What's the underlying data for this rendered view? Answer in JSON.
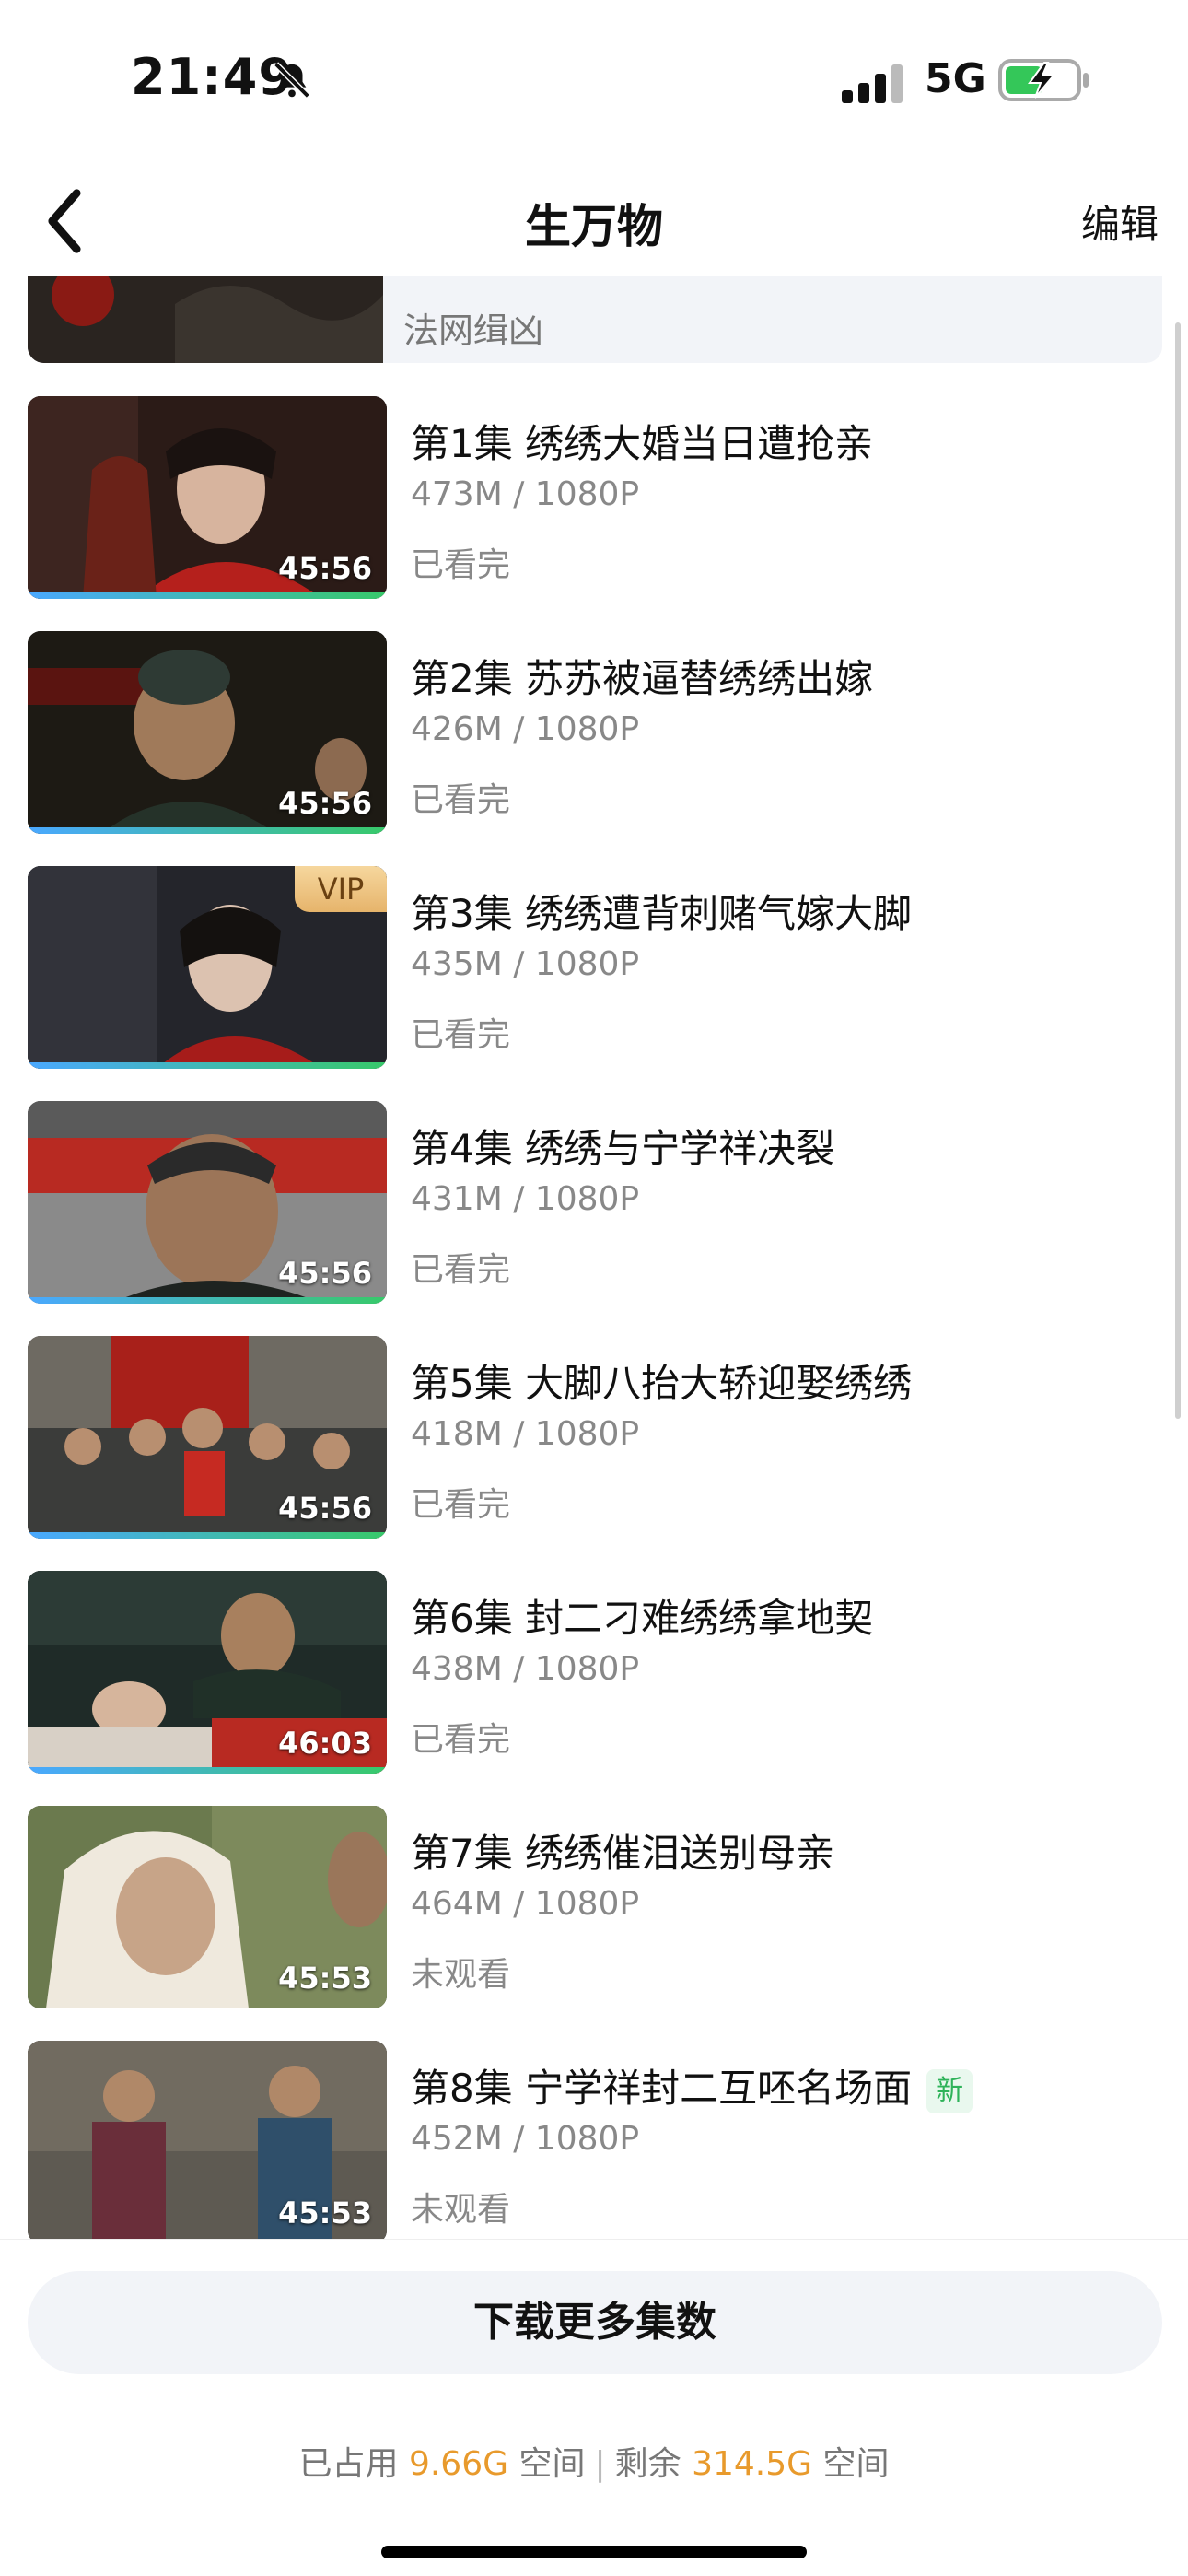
{
  "status_bar": {
    "time": "21:49",
    "network": "5G",
    "icons": [
      "bell-slash-icon",
      "signal-icon",
      "battery-charging-icon"
    ]
  },
  "nav": {
    "title": "生万物",
    "edit_label": "编辑",
    "back_icon": "chevron-left-icon"
  },
  "partial_item": {
    "label": "法网缉凶"
  },
  "episodes": [
    {
      "title": "第1集  绣绣大婚当日遭抢亲",
      "meta": "473M  /  1080P",
      "status": "已看完",
      "duration": "45:56",
      "progress": 1.0,
      "vip": false,
      "new": false
    },
    {
      "title": "第2集  苏苏被逼替绣绣出嫁",
      "meta": "426M  /  1080P",
      "status": "已看完",
      "duration": "45:56",
      "progress": 1.0,
      "vip": false,
      "new": false
    },
    {
      "title": "第3集  绣绣遭背刺赌气嫁大脚",
      "meta": "435M  /  1080P",
      "status": "已看完",
      "duration": "",
      "progress": 1.0,
      "vip": true,
      "vip_label": "VIP",
      "new": false
    },
    {
      "title": "第4集  绣绣与宁学祥决裂",
      "meta": "431M  /  1080P",
      "status": "已看完",
      "duration": "45:56",
      "progress": 1.0,
      "vip": false,
      "new": false
    },
    {
      "title": "第5集  大脚八抬大轿迎娶绣绣",
      "meta": "418M  /  1080P",
      "status": "已看完",
      "duration": "45:56",
      "progress": 1.0,
      "vip": false,
      "new": false
    },
    {
      "title": "第6集  封二刁难绣绣拿地契",
      "meta": "438M  /  1080P",
      "status": "已看完",
      "duration": "46:03",
      "progress": 1.0,
      "vip": false,
      "new": false
    },
    {
      "title": "第7集  绣绣催泪送别母亲",
      "meta": "464M  /  1080P",
      "status": "未观看",
      "duration": "45:53",
      "progress": 0,
      "vip": false,
      "new": false
    },
    {
      "title": "第8集  宁学祥封二互呸名场面",
      "meta": "452M  /  1080P",
      "status": "未观看",
      "duration": "45:53",
      "progress": 0,
      "vip": false,
      "new": true,
      "new_label": "新"
    }
  ],
  "bottom": {
    "download_more_label": "下载更多集数",
    "storage_used_prefix": "已占用",
    "storage_used_value": "9.66G",
    "storage_used_suffix": "空间",
    "storage_free_prefix": "剩余",
    "storage_free_value": "314.5G",
    "storage_free_suffix": "空间"
  },
  "colors": {
    "accent_orange": "#e89a2c",
    "progress_start": "#4aa8ff",
    "progress_end": "#38c96a",
    "new_badge_green": "#2fb35a"
  }
}
